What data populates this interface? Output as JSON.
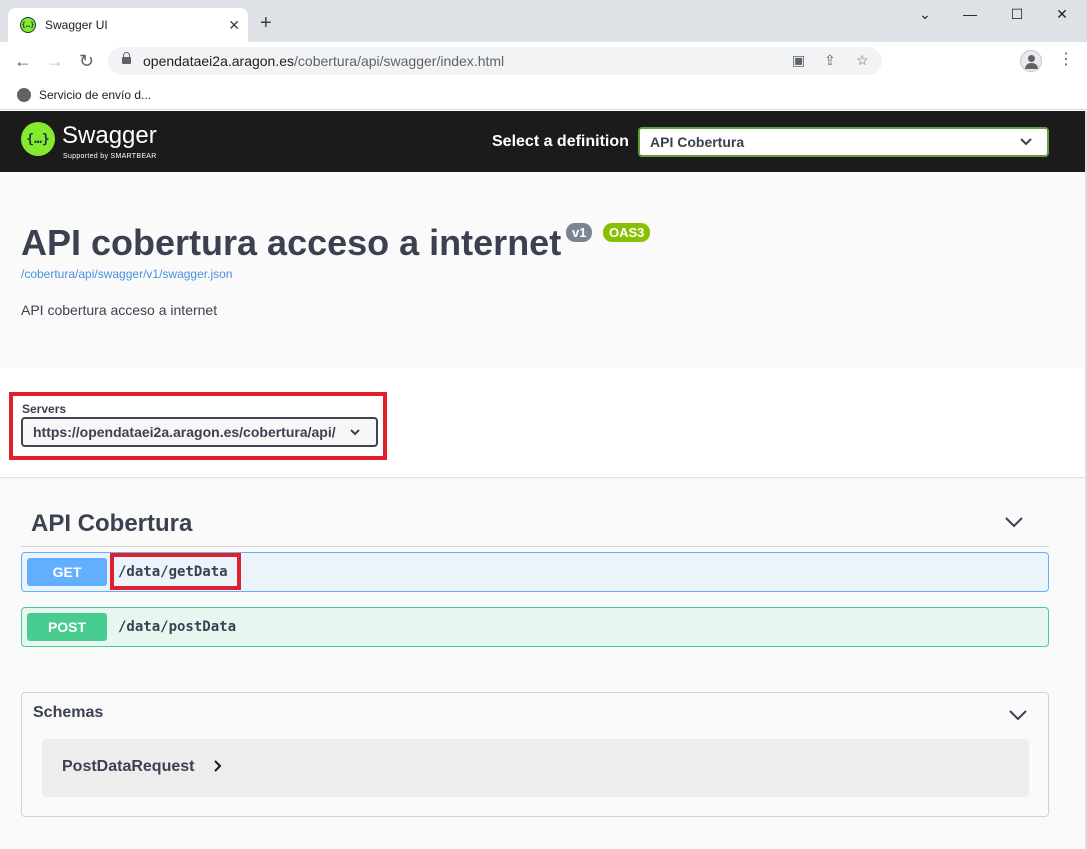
{
  "browser": {
    "tab_title": "Swagger UI",
    "tab_close": "✕",
    "new_tab": "+",
    "win_min": "⌄",
    "win_minimize": "—",
    "win_restore": "☐",
    "win_close": "✕",
    "url_host": "opendataei2a.aragon.es",
    "url_path": "/cobertura/api/swagger/index.html",
    "bookmark_label": "Servicio de envío d..."
  },
  "swagger": {
    "logo_text": "Swagger",
    "logo_sub": "Supported by SMARTBEAR",
    "select_label": "Select a definition",
    "selected_definition": "API Cobertura",
    "api_title": "API cobertura acceso a internet",
    "version_badge": "v1",
    "oas_badge": "OAS3",
    "spec_url": "/cobertura/api/swagger/v1/swagger.json",
    "description": "API cobertura acceso a internet",
    "servers_label": "Servers",
    "server_url": "https://opendataei2a.aragon.es/cobertura/api/",
    "tag_name": "API Cobertura",
    "operations": [
      {
        "method": "GET",
        "path": "/data/getData"
      },
      {
        "method": "POST",
        "path": "/data/postData"
      }
    ],
    "schemas_title": "Schemas",
    "models": [
      "PostDataRequest"
    ]
  },
  "colors": {
    "get": "#61affe",
    "post": "#49cc90",
    "highlight": "#e0202c",
    "topbar": "#1b1b1b",
    "brand_green": "#85ea2d"
  }
}
